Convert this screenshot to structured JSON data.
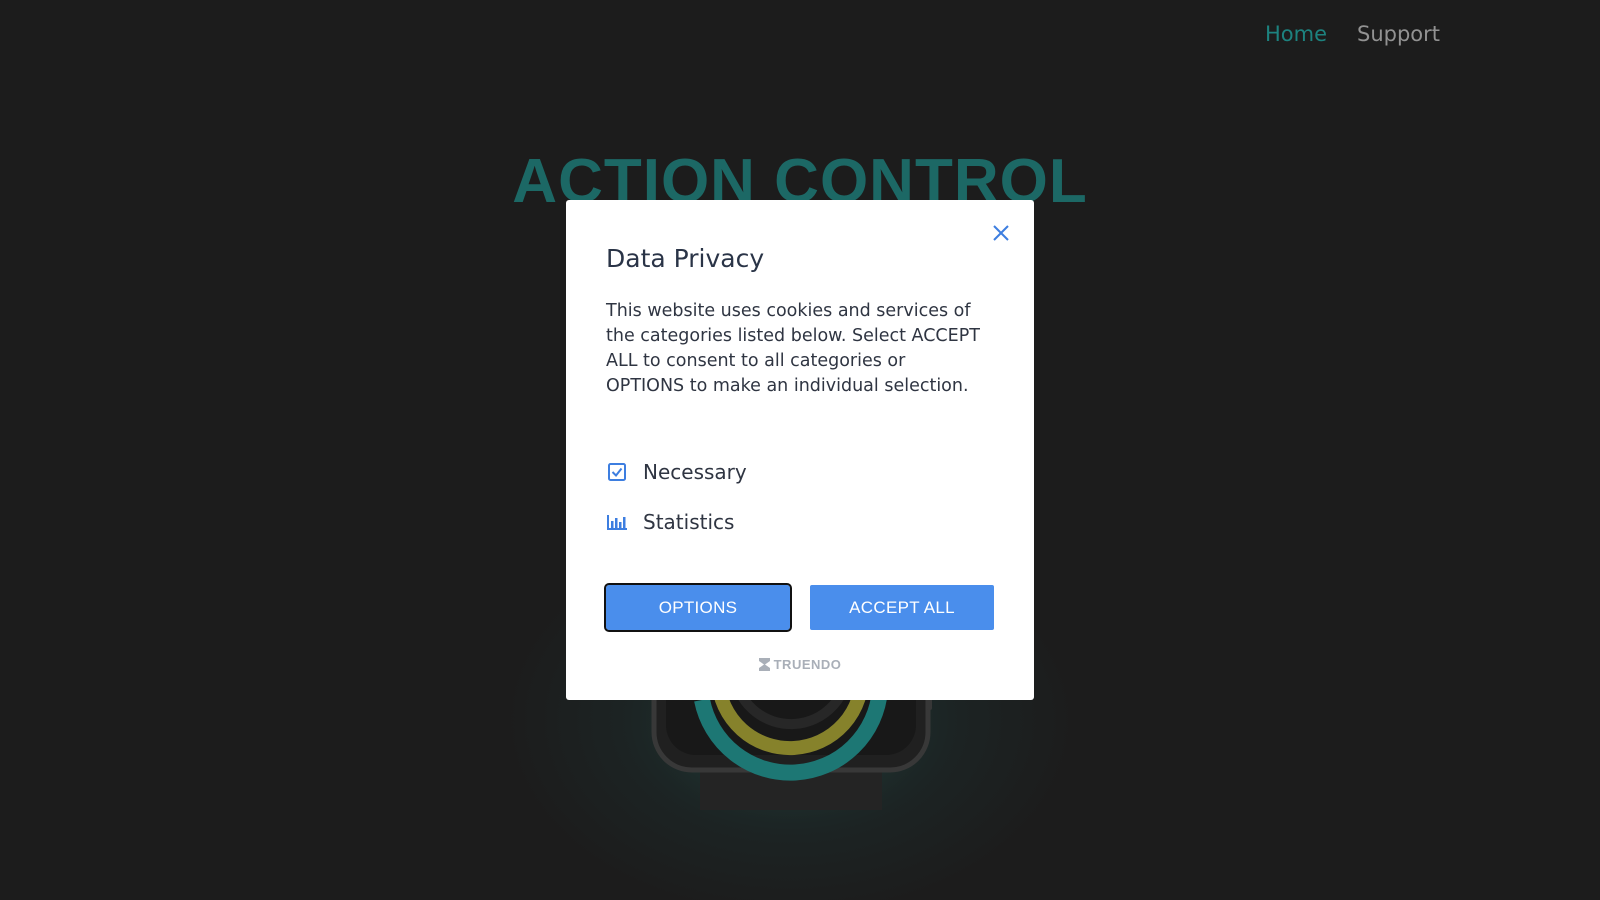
{
  "nav": {
    "items": [
      {
        "label": "Home",
        "active": true
      },
      {
        "label": "Support",
        "active": false
      }
    ]
  },
  "hero": {
    "title": "ACTION CONTROL"
  },
  "modal": {
    "title": "Data Privacy",
    "description": "This website uses cookies and services of the categories listed below. Select ACCEPT ALL to consent to all categories or OPTIONS to make an individual selection.",
    "categories": [
      {
        "label": "Necessary",
        "icon": "checkbox-checked-icon"
      },
      {
        "label": "Statistics",
        "icon": "bar-chart-icon"
      }
    ],
    "options_label": "OPTIONS",
    "accept_all_label": "ACCEPT ALL",
    "brand": "TRUENDO",
    "close_icon": "close-icon"
  },
  "colors": {
    "accent_teal": "#1f8a86",
    "hero_teal": "#1e6e6b",
    "button_blue": "#4a8eec",
    "background": "#1e1e1e"
  }
}
